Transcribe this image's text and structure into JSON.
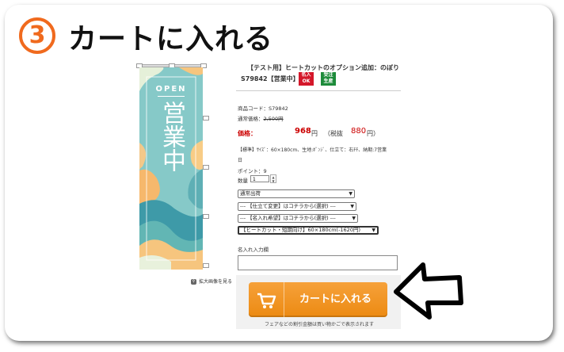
{
  "step": {
    "number": "3",
    "title": "カートに入れる"
  },
  "banner": {
    "open_text": "OPEN",
    "main_text": "営業中"
  },
  "zoom_link": "拡大画像を見る",
  "product": {
    "name": "【テスト用】ヒートカットのオプション追加：のぼり",
    "code_line": "S79842【営業中】",
    "badges": [
      {
        "text": "名入\nOK",
        "color": "#d4172a"
      },
      {
        "text": "受注\n生産",
        "color": "#1d8b3a"
      }
    ],
    "item_code": "商品コード：S79842",
    "regular_price_label": "通常価格：",
    "regular_price": "2,500円",
    "price_label": "価格：",
    "price": "968",
    "price_unit": "円",
    "tax_label": "（税抜",
    "price_excl": "880",
    "price_excl_unit": "円）",
    "spec": "【標準】ｻｲｽﾞ：60×180cm、生地:ﾎﾟﾝｼﾞ、仕立て：右ﾁﾁ、納期:7営業",
    "spec_cont": "日",
    "points": "ポイント：9",
    "qty_label": "数量",
    "qty_value": "1"
  },
  "selects": [
    {
      "value": "通常出荷"
    },
    {
      "value": "--- 【仕立て変更】はコチラから(選択) ---"
    },
    {
      "value": "--- 【名入れ希望】はコチラから(選択) ---"
    },
    {
      "value": "【ヒートカット・短期向け】60×180cm(-1620円)"
    }
  ],
  "name_input_label": "名入れ入力欄",
  "cart": {
    "button_label": "カートに入れる",
    "note": "フェアなどの割引金額は買い物かごで表示されます"
  },
  "colors": {
    "accent": "#f06a1e",
    "cart": "#f09a27",
    "price": "#cc0000"
  }
}
